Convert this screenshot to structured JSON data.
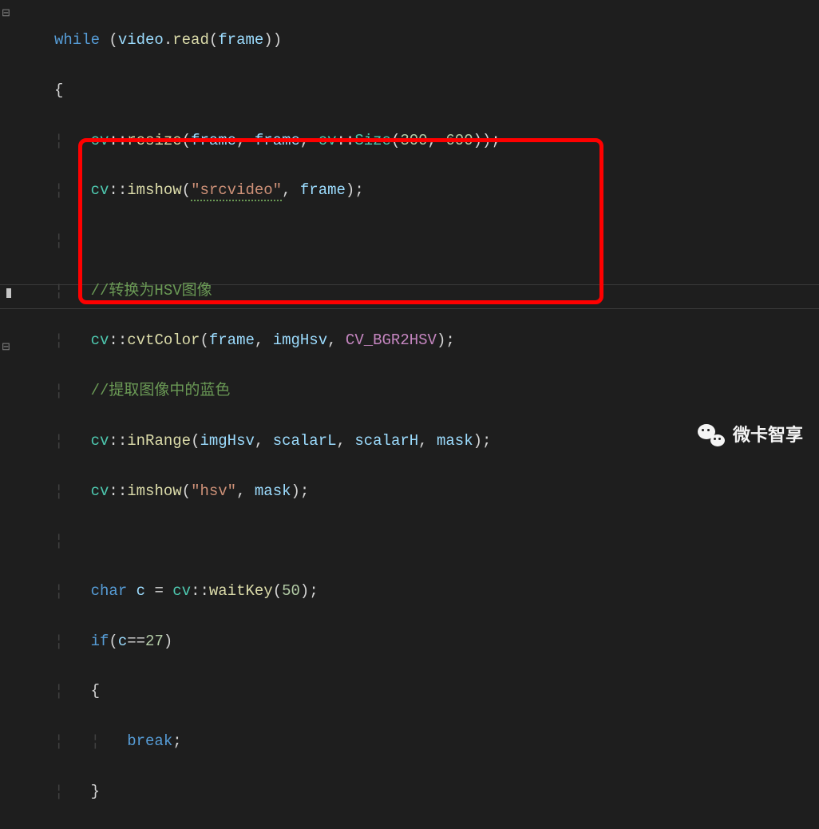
{
  "code": {
    "l1": {
      "kw": "while",
      "obj": "video",
      "fn": "read",
      "arg": "frame"
    },
    "l3": {
      "ns": "cv",
      "fn": "resize",
      "a1": "frame",
      "a2": "frame",
      "nsB": "cv",
      "type": "Size",
      "n1": "300",
      "n2": "600"
    },
    "l4": {
      "ns": "cv",
      "fn": "imshow",
      "str": "\"srcvideo\"",
      "a2": "frame"
    },
    "l6": {
      "comment": "//转换为HSV图像"
    },
    "l7": {
      "ns": "cv",
      "fn": "cvtColor",
      "a1": "frame",
      "a2": "imgHsv",
      "macro": "CV_BGR2HSV"
    },
    "l8": {
      "comment": "//提取图像中的蓝色"
    },
    "l9": {
      "ns": "cv",
      "fn": "inRange",
      "a1": "imgHsv",
      "a2": "scalarL",
      "a3": "scalarH",
      "a4": "mask"
    },
    "l10": {
      "ns": "cv",
      "fn": "imshow",
      "str": "\"hsv\"",
      "a2": "mask"
    },
    "l12": {
      "kw": "char",
      "var": "c",
      "ns": "cv",
      "fn": "waitKey",
      "n": "50"
    },
    "l13": {
      "kw": "if",
      "var": "c",
      "n": "27"
    },
    "l15": {
      "kw": "break"
    }
  },
  "watermark": "微卡智享"
}
